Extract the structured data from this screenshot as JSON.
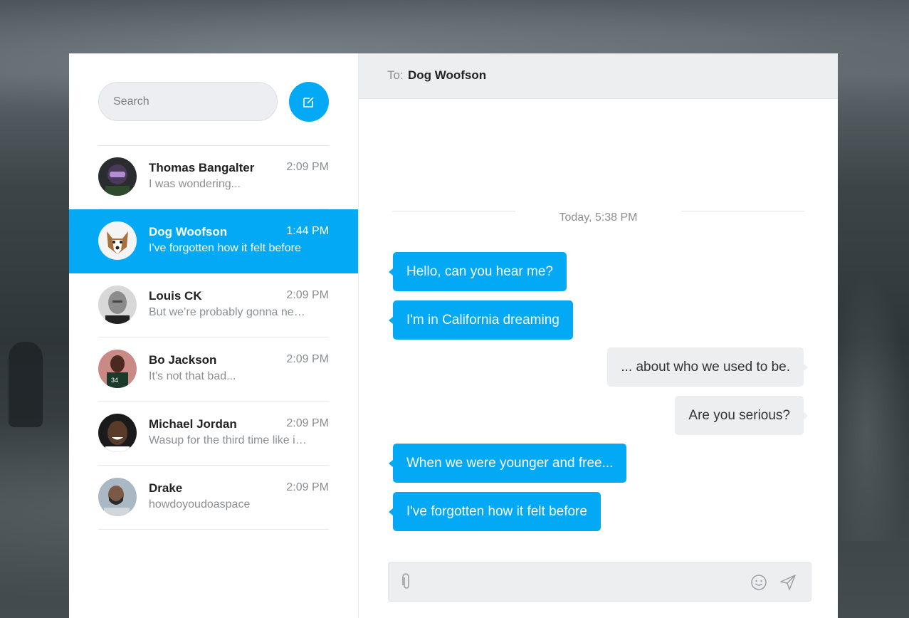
{
  "search": {
    "placeholder": "Search"
  },
  "compose_icon": "compose-icon",
  "contacts": [
    {
      "name": "Thomas Bangalter",
      "time": "2:09 PM",
      "preview": "I was wondering...",
      "active": false
    },
    {
      "name": "Dog Woofson",
      "time": "1:44 PM",
      "preview": "I've forgotten how it felt before",
      "active": true
    },
    {
      "name": "Louis CK",
      "time": "2:09 PM",
      "preview": "But we’re probably gonna need a new carpet.",
      "active": false
    },
    {
      "name": "Bo Jackson",
      "time": "2:09 PM",
      "preview": "It’s not that bad...",
      "active": false
    },
    {
      "name": "Michael Jordan",
      "time": "2:09 PM",
      "preview": "Wasup for the third time like is you blind bitch",
      "active": false
    },
    {
      "name": "Drake",
      "time": "2:09 PM",
      "preview": "howdoyoudoaspace",
      "active": false
    }
  ],
  "chat": {
    "to_label": "To:",
    "to_name": "Dog Woofson",
    "date": "Today, 5:38 PM",
    "messages": [
      {
        "from": "you",
        "text": "Hello, can you hear me?"
      },
      {
        "from": "you",
        "text": "I'm in California dreaming"
      },
      {
        "from": "me",
        "text": "... about who we used to be."
      },
      {
        "from": "me",
        "text": "Are you serious?"
      },
      {
        "from": "you",
        "text": "When we were younger and free..."
      },
      {
        "from": "you",
        "text": "I've forgotten how it felt before"
      }
    ],
    "composer": {
      "placeholder": ""
    }
  },
  "colors": {
    "accent": "#03a9f4",
    "bubble_me": "#eceef0",
    "header": "#eceef0"
  }
}
